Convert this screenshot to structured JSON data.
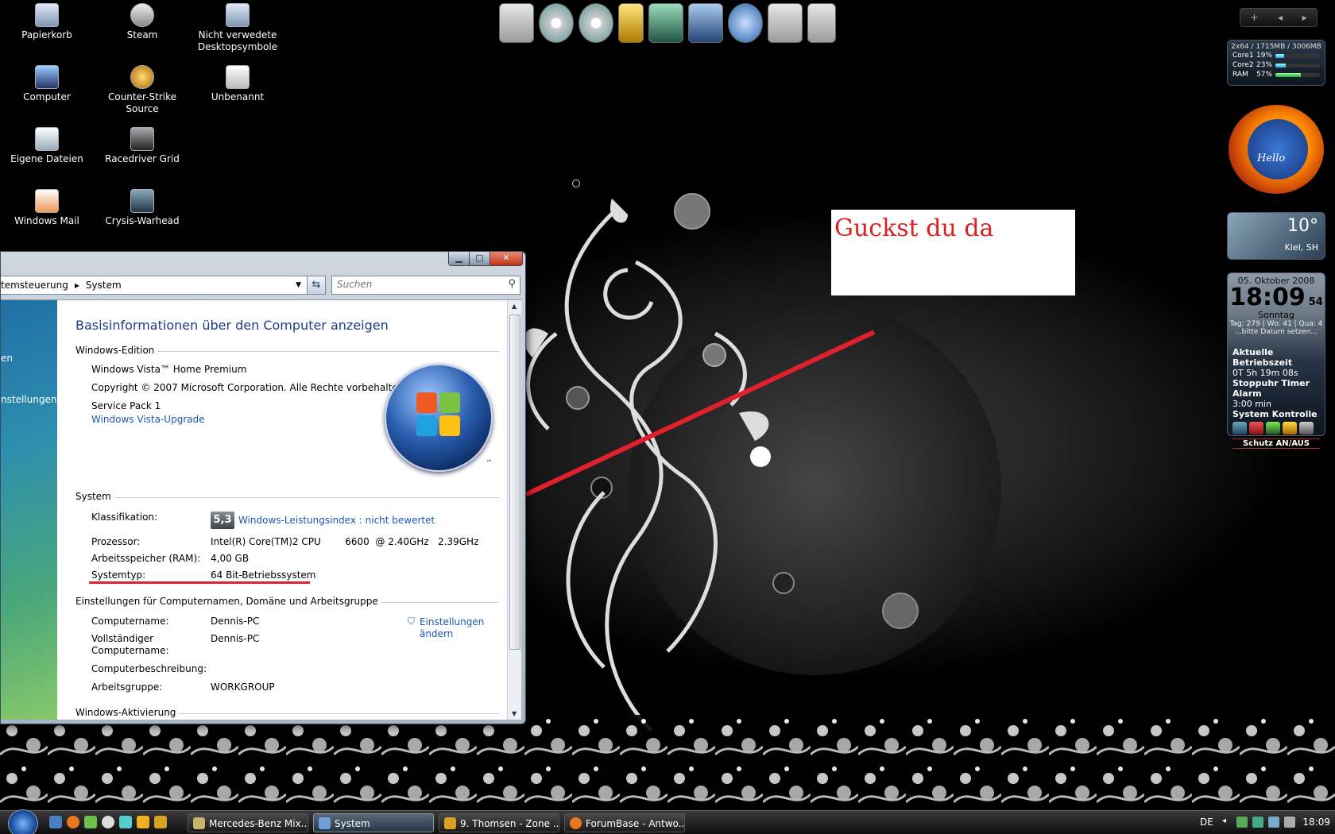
{
  "desktop_icons": [
    {
      "label": "Papierkorb",
      "icon": "recycle-bin-icon"
    },
    {
      "label": "Steam",
      "icon": "steam-icon"
    },
    {
      "label": "Nicht verwedete Desktopsymbole",
      "icon": "folder-icon"
    },
    {
      "label": "Computer",
      "icon": "computer-icon"
    },
    {
      "label": "Counter-Strike Source",
      "icon": "game-icon"
    },
    {
      "label": "Unbenannt",
      "icon": "window-icon"
    },
    {
      "label": "Eigene Dateien",
      "icon": "documents-icon"
    },
    {
      "label": "Racedriver Grid",
      "icon": "game-icon"
    },
    {
      "label": "Windows Mail",
      "icon": "mail-icon"
    },
    {
      "label": "Crysis-Warhead",
      "icon": "game-icon"
    }
  ],
  "annotation": {
    "text": "Guckst du da",
    "color": "#e02020"
  },
  "gadgets": {
    "meter": {
      "header": "2x64 / 1715MB / 3006MB",
      "rows": [
        {
          "label": "Core1",
          "pct": "19%",
          "value": 0.19
        },
        {
          "label": "Core2",
          "pct": "23%",
          "value": 0.23
        },
        {
          "label": "RAM",
          "pct": "57%",
          "value": 0.57
        }
      ]
    },
    "clock_brand": "Hello",
    "weather": {
      "temp": "10°",
      "city": "Kiel, SH"
    },
    "calendar": {
      "date": "05. Oktober 2008",
      "time": "18:09",
      "seconds": "54",
      "weekday": "Sonntag",
      "week_info": "Tag: 279 | Wo: 41 | Qua: 4",
      "note": "...bitte Datum setzen...",
      "uptime_label": "Aktuelle Betriebszeit",
      "uptime": "0T 5h 19m 08s",
      "timer_label": "Stoppuhr Timer Alarm",
      "timer": "3:00 min",
      "control_label": "System Kontrolle",
      "protect_label": "Schutz AN/AUS"
    }
  },
  "window": {
    "breadcrumb": [
      "temsteuerung",
      "System"
    ],
    "search_placeholder": "Suchen",
    "nav_items": [
      "en",
      "nstellungen"
    ],
    "title": "Basisinformationen über den Computer anzeigen",
    "edition": {
      "header": "Windows-Edition",
      "name": "Windows Vista™ Home Premium",
      "copyright": "Copyright © 2007 Microsoft Corporation. Alle Rechte vorbehalten.",
      "service_pack": "Service Pack 1",
      "upgrade_link": "Windows Vista-Upgrade"
    },
    "system": {
      "header": "System",
      "rating_label": "Klassifikation:",
      "rating_value": "5,3",
      "rating_link": "Windows-Leistungsindex : nicht bewertet",
      "cpu_label": "Prozessor:",
      "cpu_value": "Intel(R) Core(TM)2 CPU        6600  @ 2.40GHz   2.39GHz",
      "ram_label": "Arbeitsspeicher (RAM):",
      "ram_value": "4,00 GB",
      "type_label": "Systemtyp:",
      "type_value": "64 Bit-Betriebssystem"
    },
    "computer": {
      "header": "Einstellungen für Computernamen, Domäne und Arbeitsgruppe",
      "name_label": "Computername:",
      "name_value": "Dennis-PC",
      "full_label_1": "Vollständiger",
      "full_label_2": "Computername:",
      "full_value": "Dennis-PC",
      "desc_label": "Computerbeschreibung:",
      "group_label": "Arbeitsgruppe:",
      "group_value": "WORKGROUP",
      "change_link_1": "Einstellungen",
      "change_link_2": "ändern"
    },
    "activation_header": "Windows-Aktivierung"
  },
  "taskbar": {
    "tasks": [
      {
        "label": "Mercedes-Benz Mix...",
        "active": false
      },
      {
        "label": "System",
        "active": true
      },
      {
        "label": "9. Thomsen - Zone ...",
        "active": false
      },
      {
        "label": "ForumBase - Antwo...",
        "active": false
      }
    ],
    "language": "DE",
    "clock": "18:09"
  }
}
